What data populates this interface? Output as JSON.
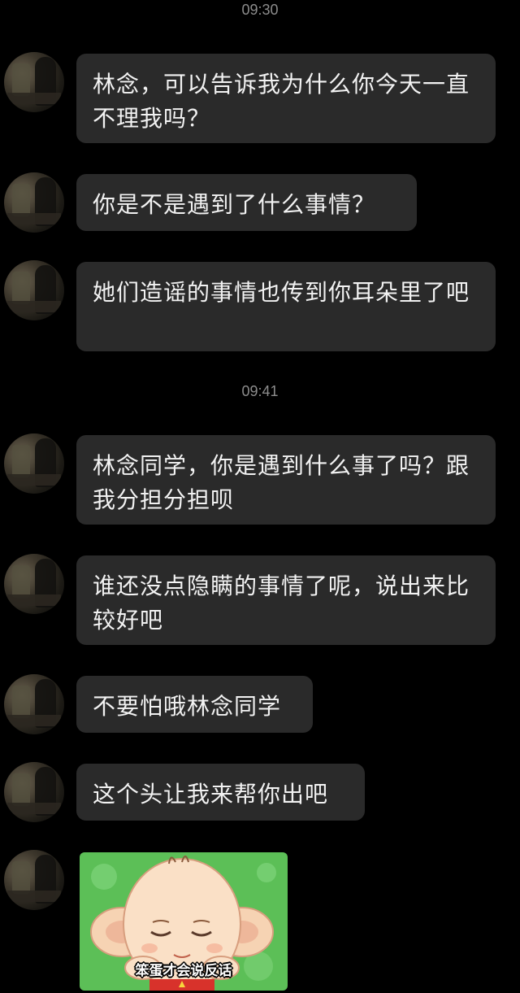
{
  "timestamps": [
    "09:30",
    "09:41"
  ],
  "messages": [
    {
      "text": "林念，可以告诉我为什么你今天一直不理我吗？"
    },
    {
      "text": "你是不是遇到了什么事情？"
    },
    {
      "text": "她们造谣的事情也传到你耳朵里了吧"
    },
    {
      "text": "林念同学，你是遇到什么事了吗？跟我分担分担呗"
    },
    {
      "text": "谁还没点隐瞒的事情了呢，说出来比较好吧"
    },
    {
      "text": "不要怕哦林念同学"
    },
    {
      "text": "这个头让我来帮你出吧"
    }
  ],
  "sticker": {
    "caption": "笨蛋才会说反话",
    "icon": "cartoon-boy-sticker"
  },
  "colors": {
    "background": "#000000",
    "bubble": "#2a2a2a",
    "text": "#f2f2f2",
    "timestamp": "#8c8c8c",
    "sticker_bg": "#5cbf57"
  }
}
